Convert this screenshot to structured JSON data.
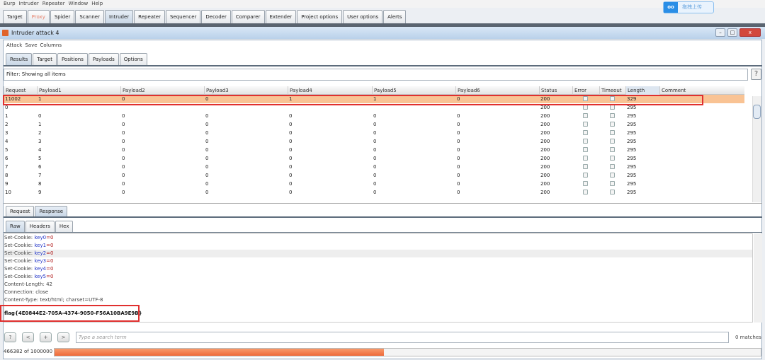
{
  "menu": [
    "Burp",
    "Intruder",
    "Repeater",
    "Window",
    "Help"
  ],
  "main_tabs": [
    "Target",
    "Proxy",
    "Spider",
    "Scanner",
    "Intruder",
    "Repeater",
    "Sequencer",
    "Decoder",
    "Comparer",
    "Extender",
    "Project options",
    "User options",
    "Alerts"
  ],
  "upload_badge": "拖拽上传",
  "window_title": "Intruder attack 4",
  "window_menu": [
    "Attack",
    "Save",
    "Columns"
  ],
  "attack_tabs": [
    "Results",
    "Target",
    "Positions",
    "Payloads",
    "Options"
  ],
  "filter": "Filter: Showing all items",
  "help_label": "?",
  "columns": [
    "Request",
    "Payload1",
    "Payload2",
    "Payload3",
    "Payload4",
    "Payload5",
    "Payload6",
    "Status",
    "Error",
    "Timeout",
    "Length",
    "Comment"
  ],
  "rows": [
    {
      "req": "11002",
      "p": [
        "1",
        "0",
        "0",
        "1",
        "1",
        "0"
      ],
      "status": "200",
      "length": "329",
      "hl": true
    },
    {
      "req": "0",
      "p": [
        "",
        "",
        "",
        "",
        "",
        ""
      ],
      "status": "200",
      "length": "295"
    },
    {
      "req": "1",
      "p": [
        "0",
        "0",
        "0",
        "0",
        "0",
        "0"
      ],
      "status": "200",
      "length": "295"
    },
    {
      "req": "2",
      "p": [
        "1",
        "0",
        "0",
        "0",
        "0",
        "0"
      ],
      "status": "200",
      "length": "295"
    },
    {
      "req": "3",
      "p": [
        "2",
        "0",
        "0",
        "0",
        "0",
        "0"
      ],
      "status": "200",
      "length": "295"
    },
    {
      "req": "4",
      "p": [
        "3",
        "0",
        "0",
        "0",
        "0",
        "0"
      ],
      "status": "200",
      "length": "295"
    },
    {
      "req": "5",
      "p": [
        "4",
        "0",
        "0",
        "0",
        "0",
        "0"
      ],
      "status": "200",
      "length": "295"
    },
    {
      "req": "6",
      "p": [
        "5",
        "0",
        "0",
        "0",
        "0",
        "0"
      ],
      "status": "200",
      "length": "295"
    },
    {
      "req": "7",
      "p": [
        "6",
        "0",
        "0",
        "0",
        "0",
        "0"
      ],
      "status": "200",
      "length": "295"
    },
    {
      "req": "8",
      "p": [
        "7",
        "0",
        "0",
        "0",
        "0",
        "0"
      ],
      "status": "200",
      "length": "295"
    },
    {
      "req": "9",
      "p": [
        "8",
        "0",
        "0",
        "0",
        "0",
        "0"
      ],
      "status": "200",
      "length": "295"
    },
    {
      "req": "10",
      "p": [
        "9",
        "0",
        "0",
        "0",
        "0",
        "0"
      ],
      "status": "200",
      "length": "295"
    }
  ],
  "rr_tabs": [
    "Request",
    "Response"
  ],
  "view_tabs": [
    "Raw",
    "Headers",
    "Hex"
  ],
  "response": {
    "cookies": [
      {
        "label": "Set-Cookie: ",
        "key": "key0",
        "val": "=0"
      },
      {
        "label": "Set-Cookie: ",
        "key": "key1",
        "val": "=0"
      },
      {
        "label": "Set-Cookie: ",
        "key": "key2",
        "val": "=0"
      },
      {
        "label": "Set-Cookie: ",
        "key": "key3",
        "val": "=0"
      },
      {
        "label": "Set-Cookie: ",
        "key": "key4",
        "val": "=0"
      },
      {
        "label": "Set-Cookie: ",
        "key": "key5",
        "val": "=0"
      }
    ],
    "headers": [
      "Content-Length: 42",
      "Connection: close",
      "Content-Type: text/html; charset=UTF-8"
    ],
    "body": "flag{4E0844E2-705A-4374-9050-F56A10BA9E9B}"
  },
  "search": {
    "buttons": [
      "?",
      "<",
      "+",
      ">"
    ],
    "placeholder": "Type a search term",
    "matches": "0 matches"
  },
  "progress": {
    "label": "466382 of 1000000",
    "fraction": 0.466382
  }
}
